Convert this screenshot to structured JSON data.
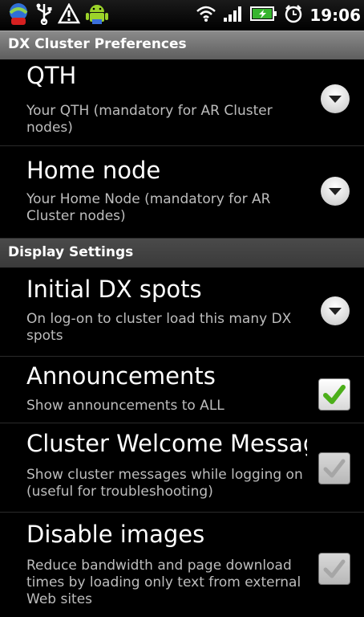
{
  "status_bar": {
    "time": "19:06",
    "icons": [
      "app-notification-icon",
      "usb-icon",
      "warning-icon",
      "android-icon",
      "wifi-icon",
      "signal-icon",
      "battery-charging-icon",
      "alarm-icon"
    ]
  },
  "title_bar": {
    "title": "DX Cluster Preferences"
  },
  "sections": [
    {
      "header": "",
      "items": [
        {
          "title": "QTH",
          "summary": "Your QTH (mandatory for AR Cluster nodes)",
          "widget": "dropdown"
        },
        {
          "title": "Home node",
          "summary": "Your Home Node (mandatory for AR Cluster nodes)",
          "widget": "dropdown"
        }
      ]
    },
    {
      "header": "Display Settings",
      "items": [
        {
          "title": "Initial DX spots",
          "summary": "On log-on to cluster load this many DX spots",
          "widget": "dropdown"
        },
        {
          "title": "Announcements",
          "summary": "Show announcements to ALL",
          "widget": "checkbox",
          "checked": true
        },
        {
          "title": "Cluster Welcome Messag",
          "summary": "Show cluster messages while logging on (useful for troubleshooting)",
          "widget": "checkbox",
          "checked": false
        },
        {
          "title": "Disable images",
          "summary": "Reduce bandwidth and page download times by loading only text from external Web sites",
          "widget": "checkbox",
          "checked": false
        }
      ]
    }
  ],
  "colors": {
    "check_green": "#4caf1a",
    "check_grey": "#c4c4c4",
    "summary_text": "#bdbdbd"
  }
}
